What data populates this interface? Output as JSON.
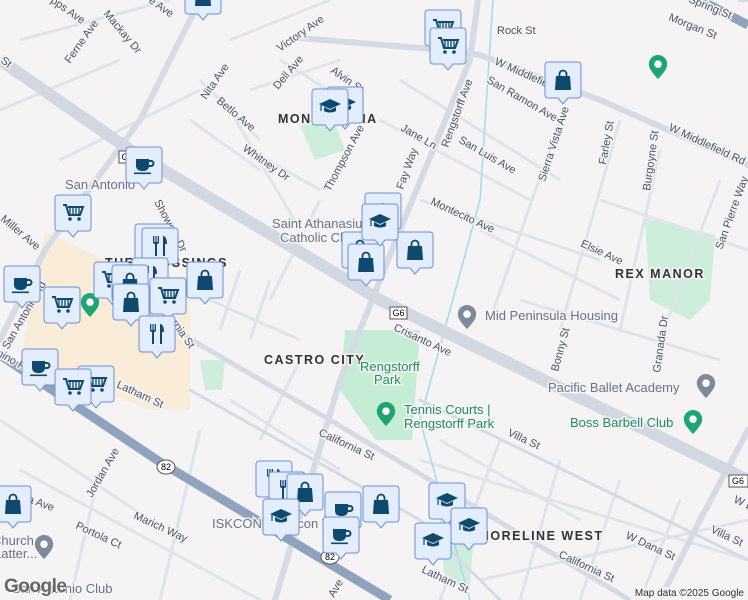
{
  "map": {
    "districts": [
      "MONTA LOMA",
      "THE CROSSINGS",
      "REX MANOR",
      "CASTRO CITY",
      "SHORELINE WEST"
    ],
    "streets": [
      "Mackay Dr",
      "Ferne Ave",
      "pps Ave",
      "e Ave",
      "Victory Ave",
      "Dell Ave",
      "Alvin St",
      "Nita Ave",
      "Betlo Ave",
      "Whitney Dr",
      "Thompson Ave",
      "Showers Dr",
      "Miller Ave",
      "Rock St",
      "Morgan St",
      "Spring St",
      "W Middlefield Rd",
      "W Middlefield Rd",
      "Rengstorff Ave",
      "San Ramon Ave",
      "Jane Ln",
      "San Luis Ave",
      "Fay Way",
      "Sierra Vista Ave",
      "Farley St",
      "Burgoyne St",
      "San Pierre Way",
      "Montecito Ave",
      "Elsie Ave",
      "Crisanto Ave",
      "Bonny St",
      "Granada Dr",
      "Villa St",
      "California St",
      "California St",
      "Villa St",
      "W Dana St",
      "Latham St",
      "Latham St",
      "Jordan Ave",
      "Portola Ave",
      "Portola Ct",
      "Marich Way",
      "San Antonio Rd",
      "El Camino Real",
      "California St",
      "Ave",
      "St",
      "W B"
    ],
    "places": {
      "san_antonio": "San Antonio",
      "saint_athanasius_1": "Saint Athanasius",
      "saint_athanasius_2": "Catholic Church",
      "mid_peninsula": "Mid Peninsula Housing",
      "rengstorff_park_1": "Rengstorff",
      "rengstorff_park_2": "Park",
      "tennis_1": "Tennis Courts |",
      "tennis_2": "Rengstorff Park",
      "pacific_ballet": "Pacific Ballet Academy",
      "boss_barbell": "Boss Barbell Club",
      "iskcon": "ISKCON of Silicon Valley",
      "church_1": "Church of",
      "church_2": "Latter...",
      "san_antonio_club": "San Antonio Club"
    },
    "shields": [
      "G6",
      "G6",
      "G6",
      "82",
      "82"
    ],
    "markers": [
      "shop",
      "cart",
      "cart",
      "shop",
      "cafe",
      "cart",
      "edu",
      "edu",
      "food",
      "food",
      "edu",
      "shop",
      "shop",
      "shop",
      "cart",
      "cafe",
      "shop",
      "food",
      "shop",
      "cart",
      "edu",
      "cart",
      "shop",
      "food",
      "cafe",
      "cart",
      "cart",
      "food",
      "food",
      "shop",
      "edu",
      "cafe",
      "cafe",
      "shop",
      "edu",
      "edu",
      "edu",
      "shop"
    ],
    "colors": {
      "marker_fill": "#e3edfb",
      "marker_border": "#6c8fd6",
      "marker_icon": "#0d4a6e",
      "park": "#c5ecd4",
      "shopping": "#f9edd9"
    }
  },
  "footer": {
    "logo": "Google",
    "attribution": "Map data ©2025 Google"
  }
}
